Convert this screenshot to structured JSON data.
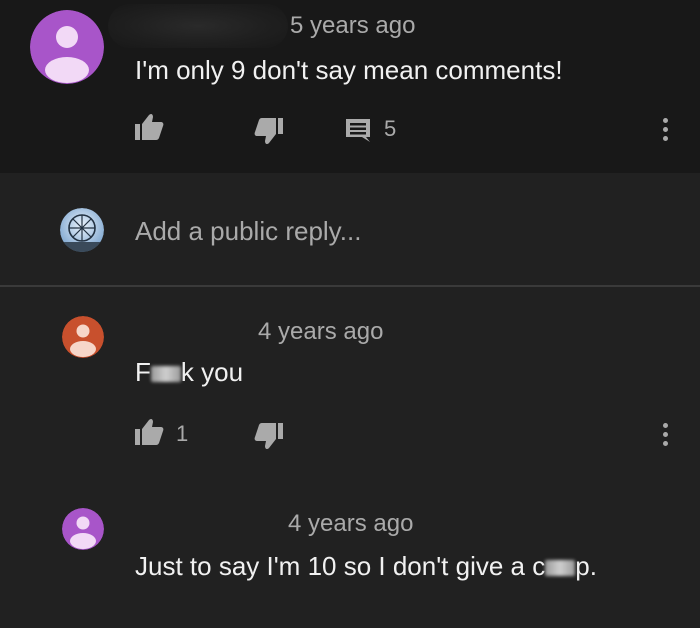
{
  "comment_1": {
    "timestamp": "5 years ago",
    "text": "I'm only 9 don't say mean comments!",
    "reply_count": "5",
    "avatar_color": "#a855c9"
  },
  "reply_input": {
    "placeholder": "Add a public reply..."
  },
  "reply_1": {
    "timestamp": "4 years ago",
    "text_prefix": "F",
    "text_suffix": "k you",
    "like_count": "1",
    "avatar_color": "#c8502d"
  },
  "reply_2": {
    "timestamp": "4 years ago",
    "text_prefix": "Just to say I'm 10 so I don't give a c",
    "text_suffix": "p.",
    "avatar_color": "#a855c9"
  },
  "icons": {
    "like": "thumb-up-icon",
    "dislike": "thumb-down-icon",
    "replies": "comment-icon",
    "more": "more-vert-icon"
  }
}
